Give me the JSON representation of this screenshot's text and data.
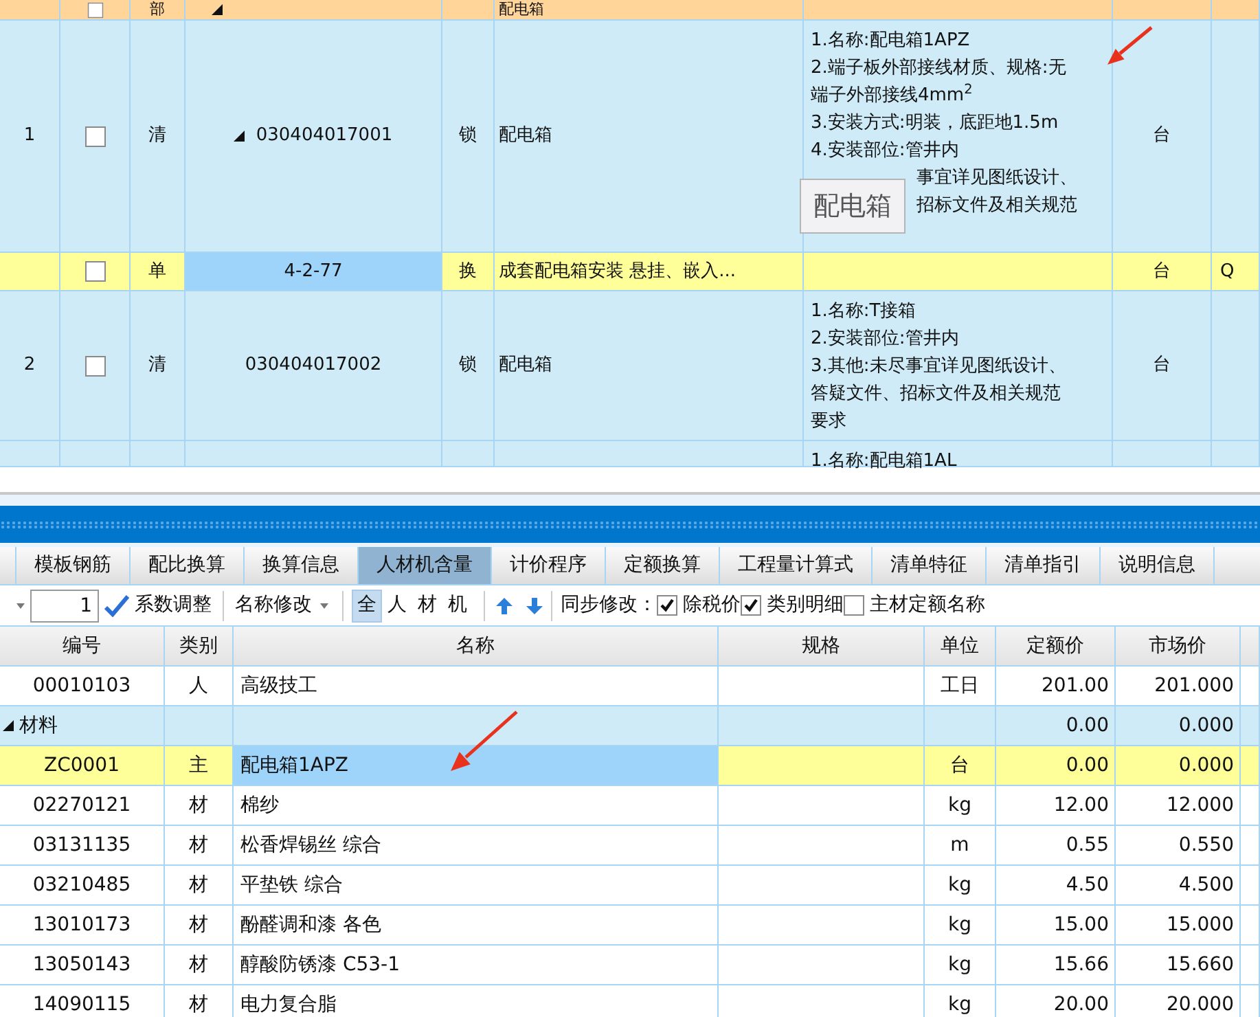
{
  "top_grid": {
    "header": {
      "checked": false,
      "type": "部",
      "name": "配电箱"
    },
    "rows": [
      {
        "kind": "bill",
        "seq": "1",
        "checked": false,
        "type": "清",
        "code": "030404017001",
        "expanded": true,
        "lock": "锁",
        "name": "配电箱",
        "features": [
          "1.名称:配电箱1APZ",
          "2.端子板外部接线材质、规格:无",
          "端子外部接线4mm$^{2}$",
          "3.安装方式:明装，底距地1.5m",
          "4.安装部位:管井内"
        ],
        "features_beside_tooltip": [
          "事宜详见图纸设计、",
          "招标文件及相关规范"
        ],
        "unit": "台"
      },
      {
        "kind": "quota",
        "checked": false,
        "type": "单",
        "code": "4-2-77",
        "lock": "换",
        "name": "成套配电箱安装 悬挂、嵌入...",
        "unit": "台",
        "extra": "Q"
      },
      {
        "kind": "bill",
        "seq": "2",
        "checked": false,
        "type": "清",
        "code": "030404017002",
        "lock": "锁",
        "name": "配电箱",
        "features": [
          "1.名称:T接箱",
          "2.安装部位:管井内",
          "3.其他:未尽事宜详见图纸设计、",
          "答疑文件、招标文件及相关规范",
          "要求"
        ],
        "unit": "台"
      },
      {
        "kind": "bill",
        "features": [
          "1.名称:配电箱1AL"
        ]
      }
    ]
  },
  "tooltip": {
    "text": "配电箱"
  },
  "bottom_tabs": [
    {
      "label": "模板钢筋",
      "selected": false
    },
    {
      "label": "配比换算",
      "selected": false
    },
    {
      "label": "换算信息",
      "selected": false
    },
    {
      "label": "人材机含量",
      "selected": true
    },
    {
      "label": "计价程序",
      "selected": false
    },
    {
      "label": "定额换算",
      "selected": false
    },
    {
      "label": "工程量计算式",
      "selected": false
    },
    {
      "label": "清单特征",
      "selected": false
    },
    {
      "label": "清单指引",
      "selected": false
    },
    {
      "label": "说明信息",
      "selected": false
    }
  ],
  "toolbar": {
    "coefficient": "1",
    "coefficient_button": "系数调整",
    "rename": "名称修改",
    "filters": [
      {
        "label": "全",
        "selected": true
      },
      {
        "label": "人",
        "selected": false
      },
      {
        "label": "材",
        "selected": false
      },
      {
        "label": "机",
        "selected": false
      }
    ],
    "sync_label": "同步修改：",
    "sync_options": [
      {
        "label": "除税价",
        "checked": true
      },
      {
        "label": "类别明细",
        "checked": true
      },
      {
        "label": "主材定额名称",
        "checked": false
      }
    ]
  },
  "detail_table": {
    "columns": [
      "编号",
      "类别",
      "名称",
      "规格",
      "单位",
      "定额价",
      "市场价"
    ],
    "rows": [
      {
        "kind": "item",
        "code": "00010103",
        "category": "人",
        "name": "高级技工",
        "unit": "工日",
        "quota_price": "201.00",
        "market_price": "201.000",
        "selected": false
      },
      {
        "kind": "group",
        "code": "材料",
        "expanded": true,
        "quota_price": "0.00",
        "market_price": "0.000",
        "selected": false
      },
      {
        "kind": "item",
        "code": "ZC0001",
        "category": "主",
        "name": "配电箱1APZ",
        "unit": "台",
        "quota_price": "0.00",
        "market_price": "0.000",
        "selected": true
      },
      {
        "kind": "item",
        "code": "02270121",
        "category": "材",
        "name": "棉纱",
        "unit": "kg",
        "quota_price": "12.00",
        "market_price": "12.000",
        "selected": false
      },
      {
        "kind": "item",
        "code": "03131135",
        "category": "材",
        "name": "松香焊锡丝 综合",
        "unit": "m",
        "quota_price": "0.55",
        "market_price": "0.550",
        "selected": false
      },
      {
        "kind": "item",
        "code": "03210485",
        "category": "材",
        "name": "平垫铁 综合",
        "unit": "kg",
        "quota_price": "4.50",
        "market_price": "4.500",
        "selected": false
      },
      {
        "kind": "item",
        "code": "13010173",
        "category": "材",
        "name": "酚醛调和漆 各色",
        "unit": "kg",
        "quota_price": "15.00",
        "market_price": "15.000",
        "selected": false
      },
      {
        "kind": "item",
        "code": "13050143",
        "category": "材",
        "name": "醇酸防锈漆 C53-1",
        "unit": "kg",
        "quota_price": "15.66",
        "market_price": "15.660",
        "selected": false
      },
      {
        "kind": "item",
        "code": "14090115",
        "category": "材",
        "name": "电力复合脂",
        "unit": "kg",
        "quota_price": "20.00",
        "market_price": "20.000",
        "selected": false
      }
    ]
  }
}
